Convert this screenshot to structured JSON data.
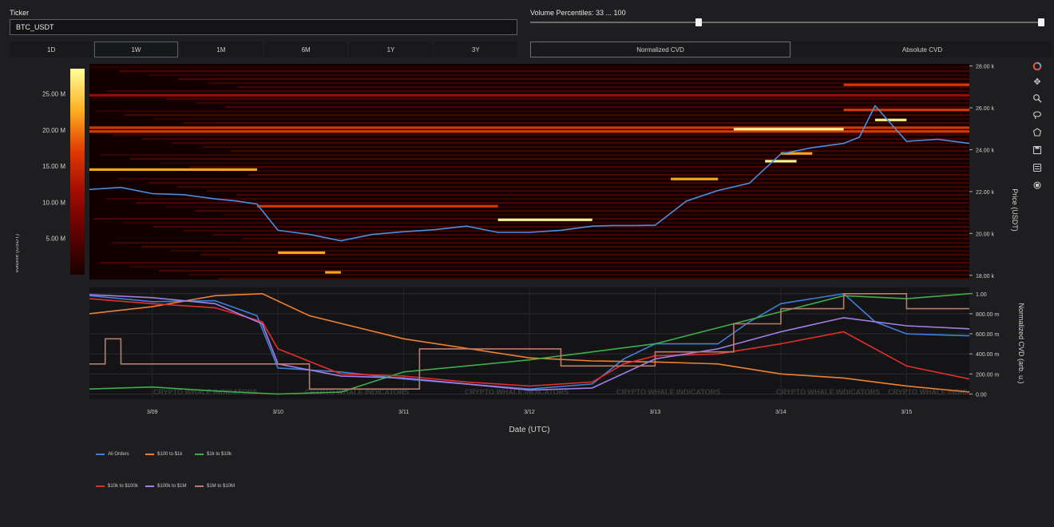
{
  "controls": {
    "ticker_label": "Ticker",
    "ticker_value": "BTC_USDT",
    "volume_label": "Volume Percentiles: 33 ... 100",
    "volume_percentile_range": [
      33,
      100
    ],
    "time_ranges": [
      "1D",
      "1W",
      "1M",
      "6M",
      "1Y",
      "3Y"
    ],
    "active_time_range": "1W",
    "modes": [
      "Normalized CVD",
      "Absolute CVD"
    ],
    "active_mode": "Normalized CVD"
  },
  "toolbar_icons": [
    "logo-icon",
    "pan-icon",
    "zoom-icon",
    "lasso-icon",
    "reset-icon",
    "save-icon",
    "zoom-in-icon",
    "zoom-out-icon"
  ],
  "chart_data": [
    {
      "type": "heatmap",
      "name": "orderbook-heatmap",
      "ylabel": "Price (USDT)",
      "y_ticks": [
        "28.00 k",
        "26.00 k",
        "24.00 k",
        "22.00 k",
        "20.00 k",
        "18.00 k"
      ],
      "y_tick_values": [
        28000,
        26000,
        24000,
        22000,
        20000,
        18000
      ],
      "ylim": [
        17800,
        28100
      ],
      "x_days": [
        "3/09",
        "3/10",
        "3/11",
        "3/12",
        "3/13",
        "3/14",
        "3/15"
      ],
      "colorbar": {
        "label": "Volume (USDT)",
        "ticks": [
          "25.00 M",
          "20.00 M",
          "15.00 M",
          "10.00 M",
          "5.00 M"
        ],
        "tick_values": [
          25,
          20,
          15,
          10,
          5
        ],
        "range": [
          0,
          28.5
        ],
        "colors": [
          "#1a0000",
          "#5e0000",
          "#a30c00",
          "#e03a00",
          "#ffb020",
          "#ffff9a"
        ]
      },
      "price_line": {
        "color": "#4a8fe0",
        "x": [
          "03-08 12:00",
          "03-08 18:00",
          "03-09 00:00",
          "03-09 06:00",
          "03-09 12:00",
          "03-09 16:00",
          "03-09 20:00",
          "03-10 00:00",
          "03-10 06:00",
          "03-10 12:00",
          "03-10 18:00",
          "03-11 00:00",
          "03-11 06:00",
          "03-11 12:00",
          "03-11 18:00",
          "03-12 00:00",
          "03-12 06:00",
          "03-12 12:00",
          "03-12 16:00",
          "03-12 20:00",
          "03-13 00:00",
          "03-13 06:00",
          "03-13 12:00",
          "03-13 18:00",
          "03-14 00:00",
          "03-14 06:00",
          "03-14 12:00",
          "03-14 15:00",
          "03-14 18:00",
          "03-15 00:00",
          "03-15 06:00",
          "03-15 12:00"
        ],
        "y": [
          22100,
          22200,
          21900,
          21850,
          21650,
          21550,
          21400,
          20150,
          19950,
          19650,
          19950,
          20080,
          20180,
          20350,
          20050,
          20050,
          20150,
          20350,
          20380,
          20380,
          20390,
          21550,
          22050,
          22400,
          23800,
          24100,
          24300,
          24600,
          26100,
          24400,
          24500,
          24300
        ]
      },
      "levels": [
        {
          "price": 25050,
          "start": "03-08 12:00",
          "end": "03-15 12:00",
          "intensity": 0.55
        },
        {
          "price": 24870,
          "start": "03-08 12:00",
          "end": "03-15 12:00",
          "intensity": 0.4
        },
        {
          "price": 26600,
          "start": "03-08 12:00",
          "end": "03-15 12:00",
          "intensity": 0.3
        },
        {
          "price": 23050,
          "start": "03-08 12:00",
          "end": "03-09 20:00",
          "intensity": 0.6
        },
        {
          "price": 21300,
          "start": "03-09 20:00",
          "end": "03-11 18:00",
          "intensity": 0.4
        },
        {
          "price": 20650,
          "start": "03-11 18:00",
          "end": "03-12 12:00",
          "intensity": 0.85
        },
        {
          "price": 19080,
          "start": "03-10 00:00",
          "end": "03-10 09:00",
          "intensity": 0.7
        },
        {
          "price": 18140,
          "start": "03-10 09:00",
          "end": "03-10 12:00",
          "intensity": 0.6
        },
        {
          "price": 24980,
          "start": "03-13 15:00",
          "end": "03-14 12:00",
          "intensity": 0.9
        },
        {
          "price": 23450,
          "start": "03-13 21:00",
          "end": "03-14 03:00",
          "intensity": 0.9
        },
        {
          "price": 23820,
          "start": "03-14 00:00",
          "end": "03-14 06:00",
          "intensity": 0.75
        },
        {
          "price": 25420,
          "start": "03-14 18:00",
          "end": "03-15 00:00",
          "intensity": 0.8
        },
        {
          "price": 22600,
          "start": "03-13 03:00",
          "end": "03-13 12:00",
          "intensity": 0.7
        },
        {
          "price": 27100,
          "start": "03-14 12:00",
          "end": "03-15 12:00",
          "intensity": 0.5
        },
        {
          "price": 25900,
          "start": "03-14 12:00",
          "end": "03-15 12:00",
          "intensity": 0.5
        }
      ]
    },
    {
      "type": "line",
      "name": "cvd-chart",
      "xlabel": "Date (UTC)",
      "ylabel": "Normalized CVD (arb. u.)",
      "y_ticks": [
        "1.00",
        "800.00 m",
        "600.00 m",
        "400.00 m",
        "200.00 m",
        "0.00"
      ],
      "y_tick_values": [
        1,
        0.8,
        0.6,
        0.4,
        0.2,
        0
      ],
      "ylim": [
        -0.02,
        1.03
      ],
      "x_ticks": [
        "3/09",
        "3/10",
        "3/11",
        "3/12",
        "3/13",
        "3/14",
        "3/15"
      ],
      "x_range": [
        "03-08 12:00",
        "03-15 12:00"
      ],
      "watermark": "CRYPTO WHALE INDICATORS",
      "legend_position": "bottom-left",
      "series": [
        {
          "name": "All Orders",
          "color": "#3f7ed9",
          "x": [
            "03-08 12:00",
            "03-09 00:00",
            "03-09 12:00",
            "03-09 20:00",
            "03-10 00:00",
            "03-10 12:00",
            "03-11 00:00",
            "03-11 12:00",
            "03-12 00:00",
            "03-12 12:00",
            "03-12 18:00",
            "03-13 00:00",
            "03-13 12:00",
            "03-13 18:00",
            "03-14 00:00",
            "03-14 12:00",
            "03-14 18:00",
            "03-15 00:00",
            "03-15 12:00"
          ],
          "y": [
            0.98,
            0.92,
            0.93,
            0.78,
            0.26,
            0.22,
            0.15,
            0.1,
            0.05,
            0.1,
            0.35,
            0.5,
            0.5,
            0.72,
            0.9,
            1.0,
            0.72,
            0.6,
            0.58
          ]
        },
        {
          "name": "$100 to $1k",
          "color": "#f08030",
          "x": [
            "03-08 12:00",
            "03-09 00:00",
            "03-09 12:00",
            "03-09 21:00",
            "03-10 06:00",
            "03-11 00:00",
            "03-12 00:00",
            "03-12 12:00",
            "03-13 00:00",
            "03-13 12:00",
            "03-14 00:00",
            "03-14 12:00",
            "03-15 00:00",
            "03-15 12:00"
          ],
          "y": [
            0.8,
            0.87,
            0.98,
            1.0,
            0.78,
            0.55,
            0.36,
            0.33,
            0.32,
            0.3,
            0.2,
            0.16,
            0.08,
            0.02
          ]
        },
        {
          "name": "$1k to $10k",
          "color": "#3fae4a",
          "x": [
            "03-08 12:00",
            "03-09 00:00",
            "03-09 12:00",
            "03-10 00:00",
            "03-10 12:00",
            "03-11 00:00",
            "03-11 12:00",
            "03-12 00:00",
            "03-12 12:00",
            "03-13 00:00",
            "03-13 12:00",
            "03-14 00:00",
            "03-14 12:00",
            "03-15 00:00",
            "03-15 12:00"
          ],
          "y": [
            0.05,
            0.07,
            0.03,
            0.0,
            0.02,
            0.22,
            0.28,
            0.34,
            0.42,
            0.5,
            0.66,
            0.82,
            0.98,
            0.95,
            1.0
          ]
        },
        {
          "name": "$10k to $100k",
          "color": "#e0302a",
          "x": [
            "03-08 12:00",
            "03-09 00:00",
            "03-09 12:00",
            "03-09 21:00",
            "03-10 00:00",
            "03-10 12:00",
            "03-11 00:00",
            "03-11 12:00",
            "03-12 00:00",
            "03-12 12:00",
            "03-12 18:00",
            "03-13 00:00",
            "03-13 12:00",
            "03-14 00:00",
            "03-14 12:00",
            "03-15 00:00",
            "03-15 12:00"
          ],
          "y": [
            0.95,
            0.9,
            0.86,
            0.72,
            0.45,
            0.2,
            0.18,
            0.12,
            0.08,
            0.12,
            0.3,
            0.38,
            0.4,
            0.5,
            0.62,
            0.28,
            0.15
          ]
        },
        {
          "name": "$100k to $1M",
          "color": "#a47ee8",
          "x": [
            "03-08 12:00",
            "03-09 00:00",
            "03-09 12:00",
            "03-09 21:00",
            "03-10 00:00",
            "03-10 12:00",
            "03-11 00:00",
            "03-11 12:00",
            "03-12 00:00",
            "03-12 12:00",
            "03-13 00:00",
            "03-13 12:00",
            "03-14 00:00",
            "03-14 12:00",
            "03-15 00:00",
            "03-15 12:00"
          ],
          "y": [
            0.99,
            0.96,
            0.9,
            0.7,
            0.3,
            0.18,
            0.16,
            0.1,
            0.04,
            0.06,
            0.35,
            0.45,
            0.62,
            0.76,
            0.68,
            0.65
          ]
        },
        {
          "name": "$1M to $10M",
          "color": "#b87b6c",
          "x": [
            "03-08 12:00",
            "03-08 15:00",
            "03-08 15:01",
            "03-08 18:00",
            "03-08 18:01",
            "03-10 06:00",
            "03-10 06:01",
            "03-11 03:00",
            "03-11 03:01",
            "03-12 06:00",
            "03-12 06:01",
            "03-13 00:00",
            "03-13 00:01",
            "03-13 15:00",
            "03-13 15:01",
            "03-14 00:00",
            "03-14 00:01",
            "03-14 12:00",
            "03-14 12:01",
            "03-15 00:00",
            "03-15 00:01",
            "03-15 12:00"
          ],
          "y": [
            0.3,
            0.3,
            0.55,
            0.55,
            0.3,
            0.3,
            0.05,
            0.05,
            0.45,
            0.45,
            0.28,
            0.28,
            0.42,
            0.42,
            0.7,
            0.7,
            0.85,
            0.85,
            1.0,
            1.0,
            0.85,
            0.85
          ]
        }
      ]
    }
  ]
}
